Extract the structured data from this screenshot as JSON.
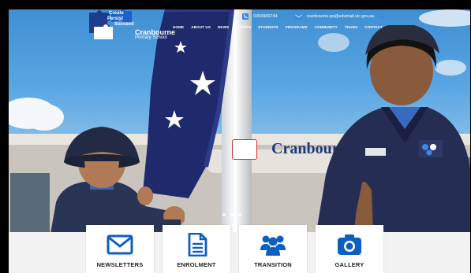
{
  "colors": {
    "brand_blue": "#0b5fc1",
    "sky": "#5aa6e2",
    "nav_text": "#ffffff",
    "tile_label": "#1e1e1e",
    "sign_navy": "#1e3b78"
  },
  "logo": {
    "tagline_1": "Create",
    "tagline_2": "Persist",
    "tagline_3": "Succeed",
    "name": "Cranbourne",
    "subtitle": "Primary School",
    "icon": "puzzle-pieces-icon"
  },
  "contact": {
    "phone_icon": "phone-icon",
    "phone": "0359965744",
    "email_icon": "envelope-icon",
    "email": "cranbourne.ps@edumail.vic.gov.au",
    "search_icon": "search-icon"
  },
  "nav": [
    {
      "label": "HOME"
    },
    {
      "label": "ABOUT US"
    },
    {
      "label": "NEWS"
    },
    {
      "label": "EVENTS"
    },
    {
      "label": "STUDENTS"
    },
    {
      "label": "PROGRAMS"
    },
    {
      "label": "COMMUNITY"
    },
    {
      "label": "TOURS"
    },
    {
      "label": "CONTACT"
    }
  ],
  "hero": {
    "sign_text": "Cranbourne P",
    "slide_count": 3,
    "active_slide": 1
  },
  "tiles": [
    {
      "label": "NEWSLETTERS",
      "icon": "envelope-icon"
    },
    {
      "label": "ENROLMENT",
      "icon": "document-icon"
    },
    {
      "label": "TRANSITION",
      "icon": "people-icon"
    },
    {
      "label": "GALLERY",
      "icon": "camera-icon"
    }
  ]
}
